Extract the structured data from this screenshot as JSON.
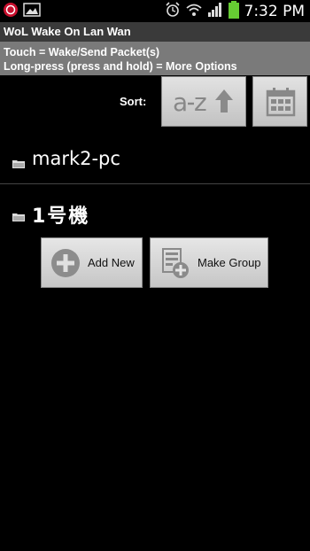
{
  "status_bar": {
    "time": "7:32 PM"
  },
  "app": {
    "title": "WoL Wake On Lan Wan"
  },
  "help": {
    "line1": "Touch = Wake/Send Packet(s)",
    "line2": "Long-press (press and hold) = More Options"
  },
  "sort": {
    "label": "Sort:"
  },
  "hosts": [
    {
      "name": "mark2-pc"
    },
    {
      "name": "1号機"
    }
  ],
  "actions": {
    "add_new": "Add New",
    "make_group": "Make Group"
  }
}
